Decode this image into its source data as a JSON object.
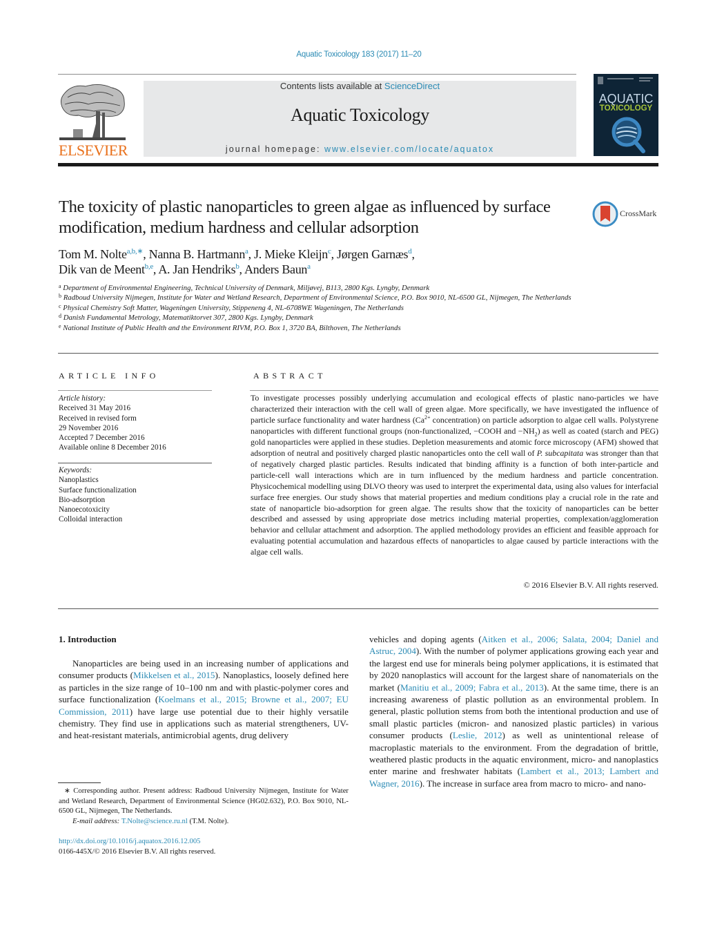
{
  "header": {
    "citation": "Aquatic Toxicology 183 (2017) 11–20",
    "contents_prefix": "Contents lists available at ",
    "contents_link": "ScienceDirect",
    "journal_name": "Aquatic Toxicology",
    "homepage_prefix": "journal homepage: ",
    "homepage_link": "www.elsevier.com/locate/aquatox",
    "publisher_logo_text": "ELSEVIER",
    "cover": {
      "title_line1": "AQUATIC",
      "title_line2": "TOXICOLOGY"
    },
    "colors": {
      "link": "#2a8ab4",
      "elsevier_orange": "#e9711c",
      "banner_bg": "#e7e8e9",
      "cover_bg": "#0e2436",
      "cover_green": "#a7c43a"
    }
  },
  "article": {
    "title": "The toxicity of plastic nanoparticles to green algae as influenced by surface modification, medium hardness and cellular adsorption",
    "crossmark_label": "CrossMark",
    "authors": [
      {
        "name": "Tom M. Nolte",
        "sup": "a,b,∗",
        "sep": ", "
      },
      {
        "name": "Nanna B. Hartmann",
        "sup": "a",
        "sep": ", "
      },
      {
        "name": "J. Mieke Kleijn",
        "sup": "c",
        "sep": ", "
      },
      {
        "name": "Jørgen Garnæs",
        "sup": "d",
        "sep": ","
      },
      {
        "name": "Dik van de Meent",
        "sup": "b,e",
        "sep": ", "
      },
      {
        "name": "A. Jan Hendriks",
        "sup": "b",
        "sep": ", "
      },
      {
        "name": "Anders Baun",
        "sup": "a",
        "sep": ""
      }
    ],
    "affiliations": [
      {
        "key": "a",
        "text": "Department of Environmental Engineering, Technical University of Denmark, Miljøvej, B113, 2800 Kgs. Lyngby, Denmark"
      },
      {
        "key": "b",
        "text": "Radboud University Nijmegen, Institute for Water and Wetland Research, Department of Environmental Science, P.O. Box 9010, NL-6500 GL, Nijmegen, The Netherlands"
      },
      {
        "key": "c",
        "text": "Physical Chemistry Soft Matter, Wageningen University, Stippeneng 4, NL-6708WE Wageningen, The Netherlands"
      },
      {
        "key": "d",
        "text": "Danish Fundamental Metrology, Matematiktorvet 307, 2800 Kgs. Lyngby, Denmark"
      },
      {
        "key": "e",
        "text": "National Institute of Public Health and the Environment RIVM, P.O. Box 1, 3720 BA, Bilthoven, The Netherlands"
      }
    ]
  },
  "article_info": {
    "heading": "ARTICLE INFO",
    "history_label": "Article history:",
    "history": [
      "Received 31 May 2016",
      "Received in revised form",
      "29 November 2016",
      "Accepted 7 December 2016",
      "Available online 8 December 2016"
    ],
    "keywords_label": "Keywords:",
    "keywords": [
      "Nanoplastics",
      "Surface functionalization",
      "Bio-adsorption",
      "Nanoecotoxicity",
      "Colloidal interaction"
    ]
  },
  "abstract": {
    "heading": "ABSTRACT",
    "part1": "To investigate processes possibly underlying accumulation and ecological effects of plastic nano-particles we have characterized their interaction with the cell wall of green algae. More specifically, we have investigated the influence of particle surface functionality and water hardness (Ca",
    "ca_sup": "2+",
    "part2": " concentration) on particle adsorption to algae cell walls. Polystyrene nanoparticles with different functional groups (non-functionalized, −COOH and −NH",
    "nh_sub": "2",
    "part3": ") as well as coated (starch and PEG) gold nanoparticles were applied in these studies. Depletion measurements and atomic force microscopy (AFM) showed that adsorption of neutral and positively charged plastic nanoparticles onto the cell wall of ",
    "species": "P. subcapitata",
    "part4": " was stronger than that of negatively charged plastic particles. Results indicated that binding affinity is a function of both inter-particle and particle-cell wall interactions which are in turn influenced by the medium hardness and particle concentration. Physicochemical modelling using DLVO theory was used to interpret the experimental data, using also values for interfacial surface free energies. Our study shows that material properties and medium conditions play a crucial role in the rate and state of nanoparticle bio-adsorption for green algae. The results show that the toxicity of nanoparticles can be better described and assessed by using appropriate dose metrics including material properties, complexation/agglomeration behavior and cellular attachment and adsorption. The applied methodology provides an efficient and feasible approach for evaluating potential accumulation and hazardous effects of nanoparticles to algae caused by particle interactions with the algae cell walls.",
    "copyright": "© 2016 Elsevier B.V. All rights reserved."
  },
  "introduction": {
    "heading": "1.  Introduction",
    "left": {
      "t1": "Nanoparticles are being used in an increasing number of applications and consumer products (",
      "c1": "Mikkelsen et al., 2015",
      "t2": "). Nanoplastics, loosely defined here as particles in the size range of 10–100 nm and with plastic-polymer cores and surface functionalization (",
      "c2": "Koelmans et al., 2015; Browne et al., 2007; EU Commission, 2011",
      "t3": ") have large use potential due to their highly versatile chemistry. They find use in applications such as material strengtheners, UV- and heat-resistant materials, antimicrobial agents, drug delivery"
    },
    "right": {
      "t1": "vehicles and doping agents (",
      "c1": "Aitken et al., 2006; Salata, 2004; Daniel and Astruc, 2004",
      "t2": "). With the number of polymer applications growing each year and the largest end use for minerals being polymer applications, it is estimated that by 2020 nanoplastics will account for the largest share of nanomaterials on the market (",
      "c2": "Manitiu et al., 2009; Fabra et al., 2013",
      "t3": "). At the same time, there is an increasing awareness of plastic pollution as an environmental problem. In general, plastic pollution stems from both the intentional production and use of small plastic particles (micron- and nanosized plastic particles) in various consumer products (",
      "c3": "Leslie, 2012",
      "t4": ") as well as unintentional release of macroplastic materials to the environment. From the degradation of brittle, weathered plastic products in the aquatic environment, micro- and nanoplastics enter marine and freshwater habitats (",
      "c4": "Lambert et al., 2013; Lambert and Wagner, 2016",
      "t5": "). The increase in surface area from macro to micro- and nano-"
    }
  },
  "footnote": {
    "star": "∗",
    "text": " Corresponding author. Present address: Radboud University Nijmegen, Institute for Water and Wetland Research, Department of Environmental Science (HG02.632), P.O. Box 9010, NL-6500 GL, Nijmegen, The Netherlands.",
    "email_label": "E-mail address: ",
    "email": "T.Nolte@science.ru.nl",
    "email_suffix": " (T.M. Nolte)."
  },
  "doi": {
    "link": "http://dx.doi.org/10.1016/j.aquatox.2016.12.005",
    "issn_line": "0166-445X/© 2016 Elsevier B.V. All rights reserved."
  }
}
